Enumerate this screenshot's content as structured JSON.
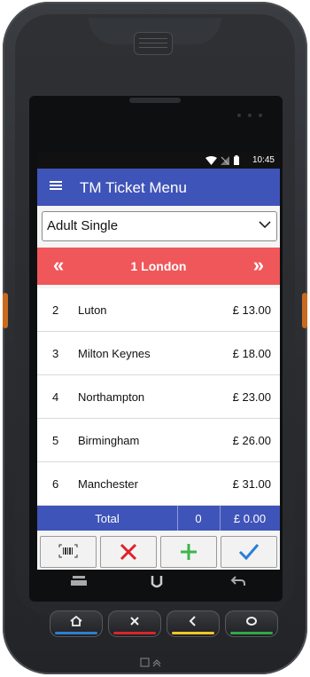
{
  "status_bar": {
    "time": "10:45",
    "wifi_icon": "wifi-icon",
    "signal_icon": "no-signal-icon",
    "battery_icon": "battery-icon"
  },
  "app_bar": {
    "menu_icon": "menu-icon",
    "title": "TM Ticket Menu"
  },
  "ticket_type": {
    "selected": "Adult Single",
    "chevron_icon": "chevron-down-icon"
  },
  "station_nav": {
    "prev_glyph": "«",
    "label": "1 London",
    "next_glyph": "»"
  },
  "destinations": [
    {
      "num": "2",
      "name": "Luton",
      "price": "£ 13.00"
    },
    {
      "num": "3",
      "name": "Milton Keynes",
      "price": "£ 18.00"
    },
    {
      "num": "4",
      "name": "Northampton",
      "price": "£ 23.00"
    },
    {
      "num": "5",
      "name": "Birmingham",
      "price": "£ 26.00"
    },
    {
      "num": "6",
      "name": "Manchester",
      "price": "£ 31.00"
    }
  ],
  "totals": {
    "label": "Total",
    "count": "0",
    "amount": "£ 0.00"
  },
  "actions": {
    "barcode_icon": "barcode-icon",
    "cancel_icon": "cross-icon",
    "add_icon": "plus-icon",
    "confirm_icon": "check-icon",
    "colors": {
      "cancel": "#e0202a",
      "add": "#3db54a",
      "confirm": "#2b7fd6"
    }
  },
  "colors": {
    "primary": "#3f54b8",
    "station_bar": "#f0575a"
  }
}
